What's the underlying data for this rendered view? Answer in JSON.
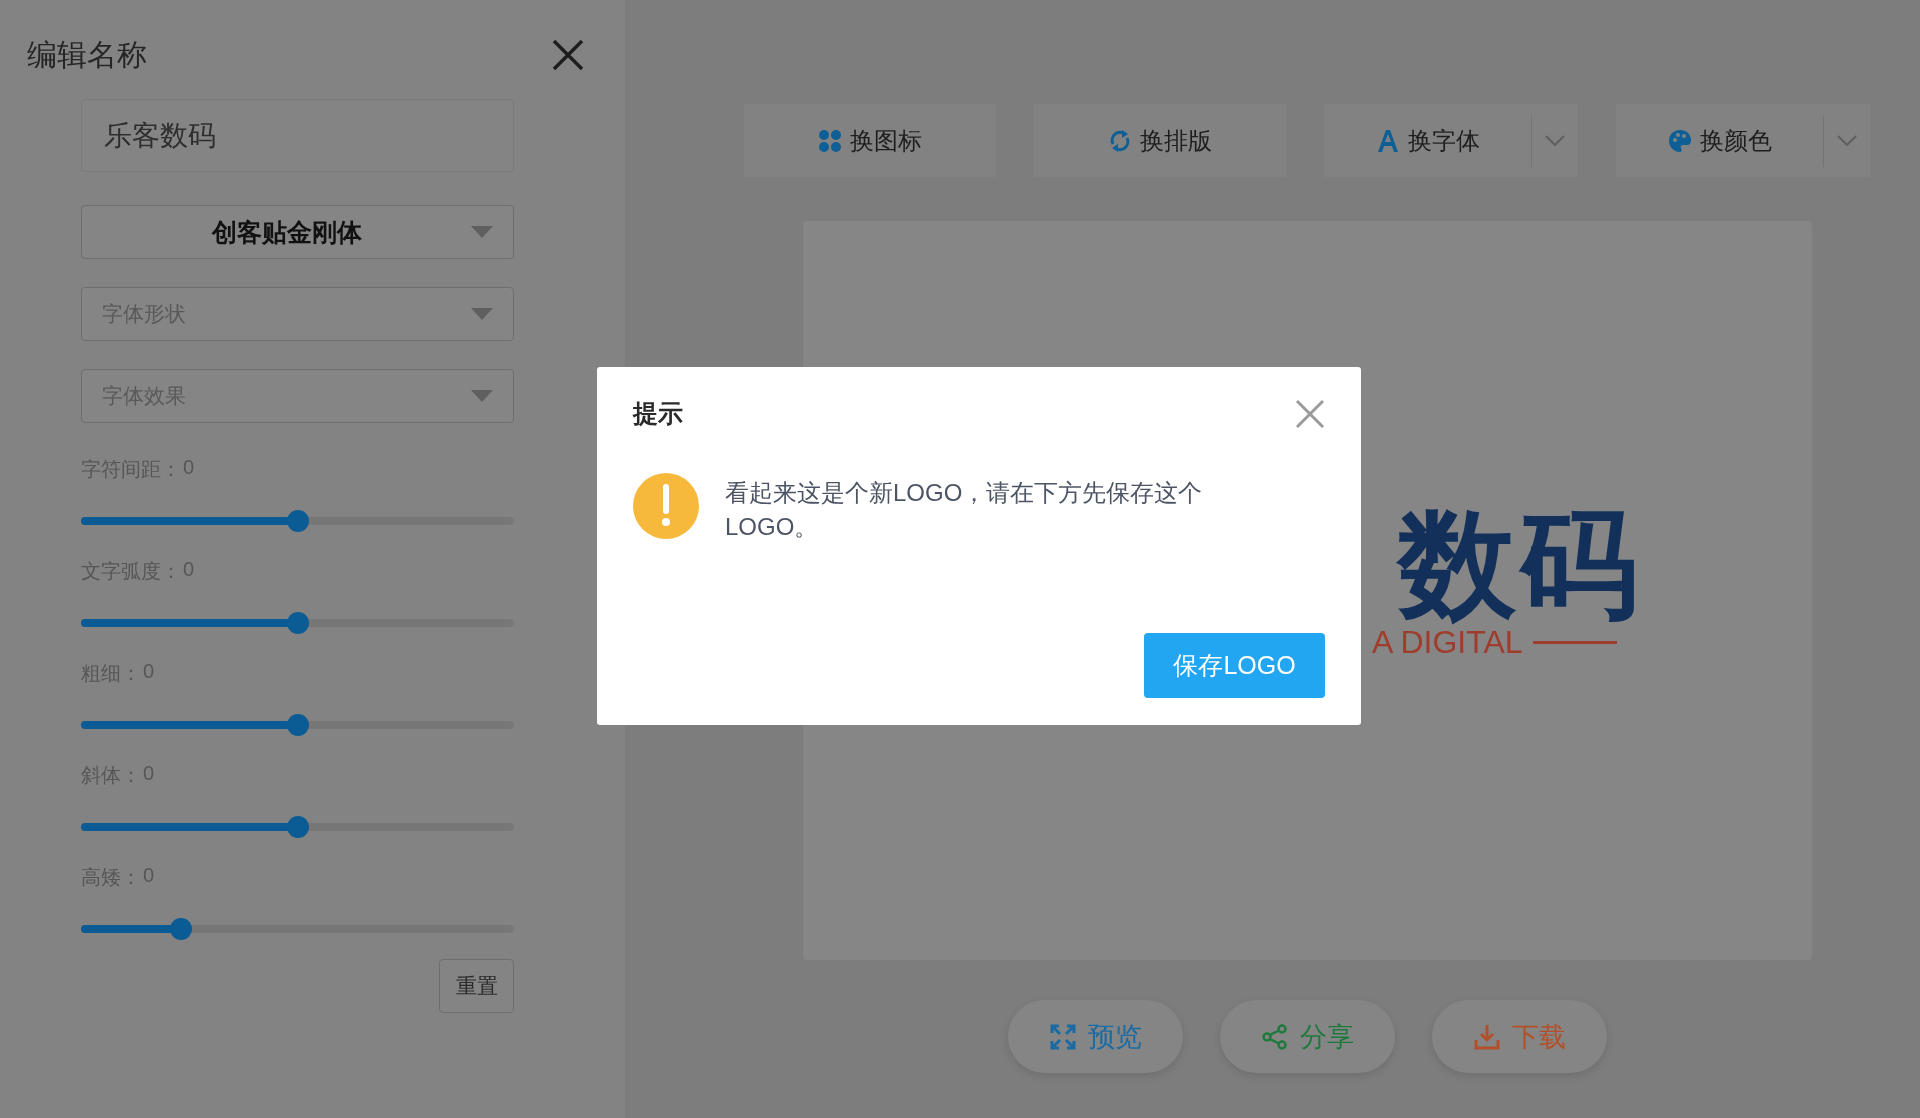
{
  "panel": {
    "title": "编辑名称",
    "name_field": {
      "value": "乐客数码"
    },
    "selects": [
      {
        "value": "创客贴金刚体"
      },
      {
        "placeholder": "字体形状"
      },
      {
        "placeholder": "字体效果"
      }
    ],
    "sliders": [
      {
        "label": "字符间距：",
        "reading": "0",
        "level": 0.5
      },
      {
        "label": "文字弧度：",
        "reading": "0",
        "level": 0.5
      },
      {
        "label": "粗细：",
        "reading": "0",
        "level": 0.5
      },
      {
        "label": "斜体：",
        "reading": "0",
        "level": 0.5
      },
      {
        "label": "高矮：",
        "reading": "0",
        "level": 0.23
      }
    ],
    "reset_button": "重置"
  },
  "toolbar": [
    {
      "label": "换图标",
      "has_menu": false
    },
    {
      "label": "换排版",
      "has_menu": false
    },
    {
      "label": "换字体",
      "has_menu": true
    },
    {
      "label": "换颜色",
      "has_menu": true
    }
  ],
  "preview": {
    "name": "数码",
    "tagline": "A DIGITAL"
  },
  "actions": [
    {
      "label": "预览",
      "color": "#1a6aa3"
    },
    {
      "label": "分享",
      "color": "#1e7a3c"
    },
    {
      "label": "下载",
      "color": "#b2502a"
    }
  ],
  "dialog": {
    "title": "提示",
    "message": "看起来这是个新LOGO，请在下方先保存这个LOGO。",
    "button": "保存LOGO"
  }
}
